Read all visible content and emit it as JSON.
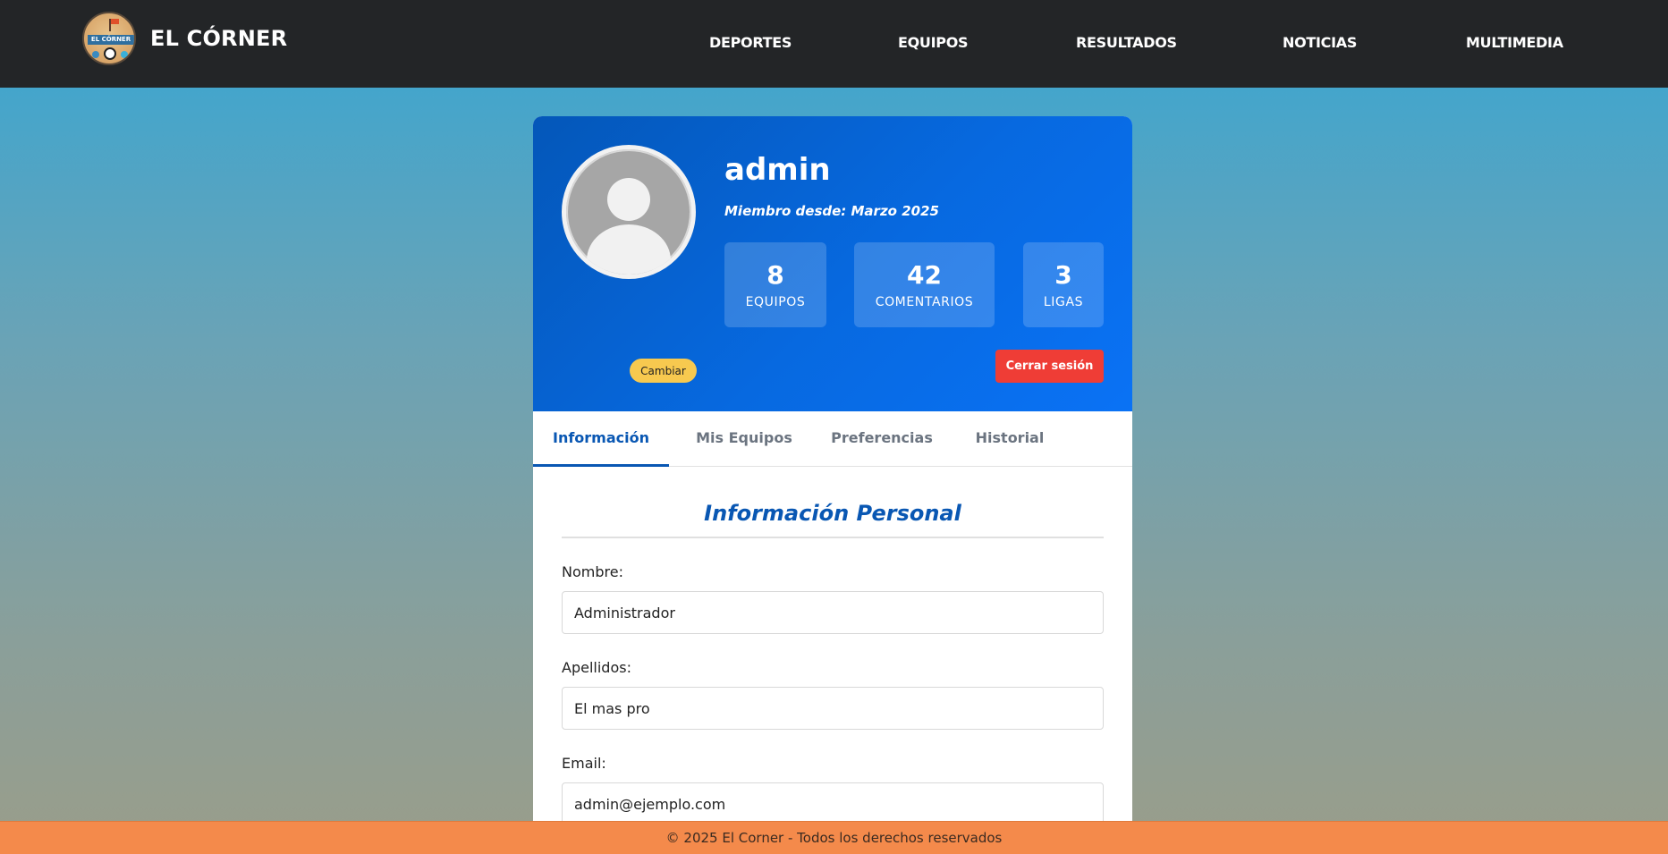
{
  "brand": {
    "name": "EL CÓRNER",
    "logo_text": "EL CÓRNER"
  },
  "nav": {
    "items": [
      {
        "label": "DEPORTES"
      },
      {
        "label": "EQUIPOS"
      },
      {
        "label": "RESULTADOS"
      },
      {
        "label": "NOTICIAS"
      },
      {
        "label": "MULTIMEDIA"
      }
    ]
  },
  "profile": {
    "username": "admin",
    "member_since": "Miembro desde: Marzo 2025",
    "change_label": "Cambiar",
    "logout_label": "Cerrar sesión",
    "stats": [
      {
        "value": "8",
        "label": "EQUIPOS"
      },
      {
        "value": "42",
        "label": "COMENTARIOS"
      },
      {
        "value": "3",
        "label": "LIGAS"
      }
    ]
  },
  "tabs": [
    {
      "label": "Información",
      "active": true
    },
    {
      "label": "Mis Equipos",
      "active": false
    },
    {
      "label": "Preferencias",
      "active": false
    },
    {
      "label": "Historial",
      "active": false
    }
  ],
  "personal_info": {
    "title": "Información Personal",
    "fields": [
      {
        "label": "Nombre:",
        "value": "Administrador"
      },
      {
        "label": "Apellidos:",
        "value": "El mas pro"
      },
      {
        "label": "Email:",
        "value": "admin@ejemplo.com"
      }
    ]
  },
  "footer": {
    "text": "© 2025 El Corner - Todos los derechos reservados"
  },
  "colors": {
    "navbar": "#232527",
    "header_blue": "#0769e0",
    "accent_blue": "#0957b3",
    "change_button": "#f7c94f",
    "logout_button": "#ef3d36",
    "footer": "#f48a4b"
  }
}
